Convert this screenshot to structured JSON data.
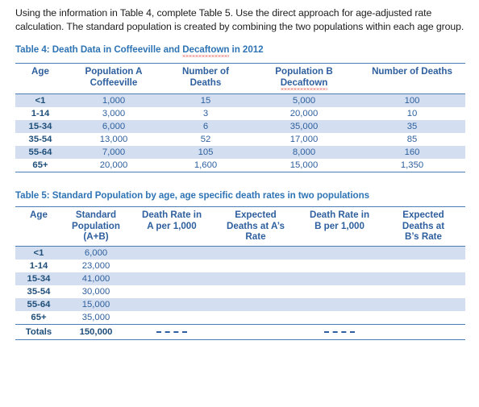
{
  "document": {
    "intro_paragraph": "Using the information in Table 4, complete Table 5. Use the direct approach for age-adjusted rate calculation. The standard population is created by combining the two populations within each age group.",
    "accent_color": "#2e74b5",
    "table_text_color": "#2e5f9e",
    "row_shade_color": "#d3dff0",
    "rule_color": "#4a7db5",
    "spellcheck_underline_color": "#e02b20"
  },
  "table4": {
    "caption_prefix": "Table 4: Death Data in Coffeeville  and ",
    "caption_flagged_word": "Decaftown",
    "caption_suffix": " in 2012",
    "columns": [
      {
        "line1": "Age",
        "line2": ""
      },
      {
        "line1": "Population A",
        "line2": "Coffeeville"
      },
      {
        "line1": "Number of",
        "line2": "Deaths"
      },
      {
        "line1": "Population B",
        "line2": "Decaftown",
        "flagged": true
      },
      {
        "line1": "Number of Deaths",
        "line2": ""
      }
    ],
    "rows": [
      {
        "age": "<1",
        "pop_a": "1,000",
        "deaths_a": "15",
        "pop_b": "5,000",
        "deaths_b": "100"
      },
      {
        "age": "1-14",
        "pop_a": "3,000",
        "deaths_a": "3",
        "pop_b": "20,000",
        "deaths_b": "10"
      },
      {
        "age": "15-34",
        "pop_a": "6,000",
        "deaths_a": "6",
        "pop_b": "35,000",
        "deaths_b": "35"
      },
      {
        "age": "35-54",
        "pop_a": "13,000",
        "deaths_a": "52",
        "pop_b": "17,000",
        "deaths_b": "85"
      },
      {
        "age": "55-64",
        "pop_a": "7,000",
        "deaths_a": "105",
        "pop_b": "8,000",
        "deaths_b": "160"
      },
      {
        "age": "65+",
        "pop_a": "20,000",
        "deaths_a": "1,600",
        "pop_b": "15,000",
        "deaths_b": "1,350"
      }
    ]
  },
  "table5": {
    "caption": "Table 5: Standard Population by age, age specific death rates in two populations",
    "columns": [
      {
        "line1": "Age",
        "line2": "",
        "line3": ""
      },
      {
        "line1": "Standard",
        "line2": "Population",
        "line3": "(A+B)"
      },
      {
        "line1": "Death Rate in",
        "line2": "A per 1,000",
        "line3": ""
      },
      {
        "line1": "Expected",
        "line2": "Deaths at A’s",
        "line3": "Rate"
      },
      {
        "line1": "Death Rate in",
        "line2": "B per 1,000",
        "line3": ""
      },
      {
        "line1": "Expected",
        "line2": "Deaths at",
        "line3": "B’s Rate"
      }
    ],
    "rows": [
      {
        "age": "<1",
        "std_pop": "6,000",
        "rate_a": "",
        "exp_a": "",
        "rate_b": "",
        "exp_b": ""
      },
      {
        "age": "1-14",
        "std_pop": "23,000",
        "rate_a": "",
        "exp_a": "",
        "rate_b": "",
        "exp_b": ""
      },
      {
        "age": "15-34",
        "std_pop": "41,000",
        "rate_a": "",
        "exp_a": "",
        "rate_b": "",
        "exp_b": ""
      },
      {
        "age": "35-54",
        "std_pop": "30,000",
        "rate_a": "",
        "exp_a": "",
        "rate_b": "",
        "exp_b": ""
      },
      {
        "age": "55-64",
        "std_pop": "15,000",
        "rate_a": "",
        "exp_a": "",
        "rate_b": "",
        "exp_b": ""
      },
      {
        "age": "65+",
        "std_pop": "35,000",
        "rate_a": "",
        "exp_a": "",
        "rate_b": "",
        "exp_b": ""
      }
    ],
    "totals": {
      "label": "Totals",
      "std_pop": "150,000",
      "rate_a": "dashed-placeholder",
      "exp_a": "",
      "rate_b": "dashed-placeholder",
      "exp_b": ""
    }
  }
}
